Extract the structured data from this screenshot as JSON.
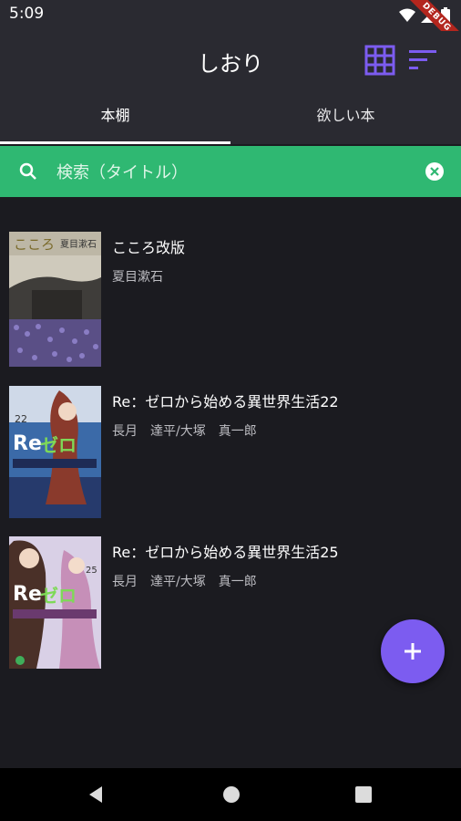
{
  "status_bar": {
    "time": "5:09",
    "debug_label": "DEBUG"
  },
  "app_bar": {
    "title": "しおり"
  },
  "tabs": [
    {
      "label": "本棚",
      "active": true
    },
    {
      "label": "欲しい本",
      "active": false
    }
  ],
  "search": {
    "placeholder": "検索（タイトル）",
    "value": ""
  },
  "books": [
    {
      "title": "こころ改版",
      "author": "夏目漱石"
    },
    {
      "title": "Re：ゼロから始める異世界生活22",
      "author": "長月　達平/大塚　真一郎"
    },
    {
      "title": "Re：ゼロから始める異世界生活25",
      "author": "長月　達平/大塚　真一郎"
    }
  ],
  "colors": {
    "accent": "#7c5cf0",
    "search_bar": "#2fb872",
    "background": "#1b1b20",
    "app_bar": "#2a2a31"
  },
  "icons": {
    "grid": "grid-view-icon",
    "sort": "sort-icon",
    "search": "search-icon",
    "clear": "clear-icon",
    "add": "plus-icon"
  }
}
